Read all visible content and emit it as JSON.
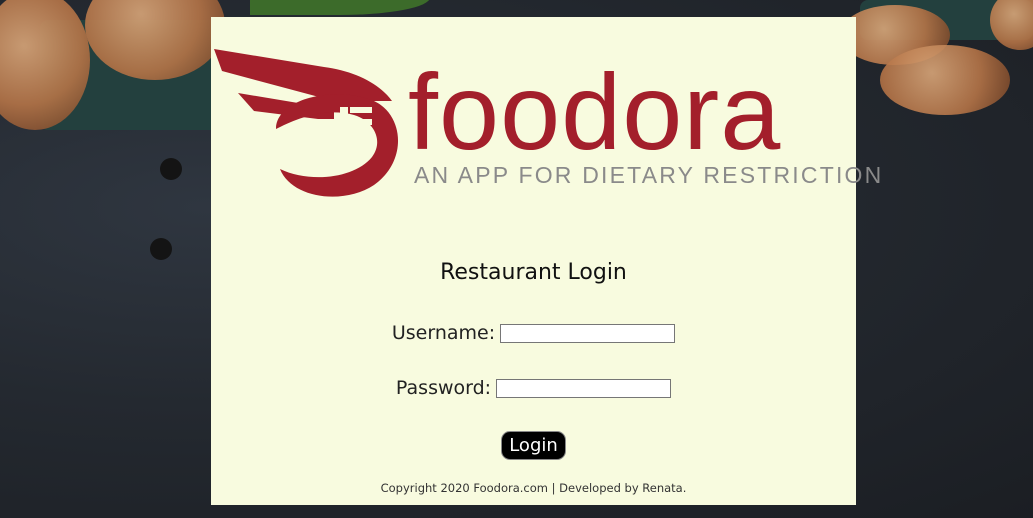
{
  "logo": {
    "word": "foodora",
    "tagline": "AN APP FOR DIETARY RESTRICTION",
    "brand_color": "#a31f2b"
  },
  "login": {
    "title": "Restaurant Login",
    "username_label": "Username:",
    "username_value": "",
    "password_label": "Password:",
    "password_value": "",
    "submit_label": "Login"
  },
  "footer": {
    "text": "Copyright 2020 Foodora.com | Developed by Renata."
  },
  "colors": {
    "card_background": "#f8fbdf",
    "button_background": "#000000"
  }
}
